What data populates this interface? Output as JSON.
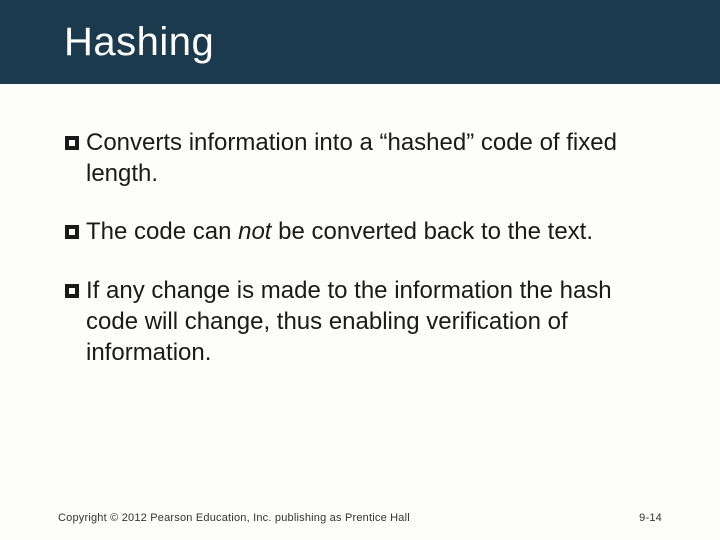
{
  "title": "Hashing",
  "bullets": [
    {
      "text_html": "Converts information into a “hashed” code of fixed length."
    },
    {
      "text_html": "The code can <em>not</em> be converted back to the text."
    },
    {
      "text_html": "If any change is made to the information the hash code will change, thus enabling verification of information."
    }
  ],
  "footer": {
    "copyright": "Copyright © 2012 Pearson Education, Inc. publishing as Prentice Hall",
    "page": "9-14"
  },
  "colors": {
    "title_bg": "#1c3a4d",
    "bullet_icon": "#1a1a1a"
  }
}
